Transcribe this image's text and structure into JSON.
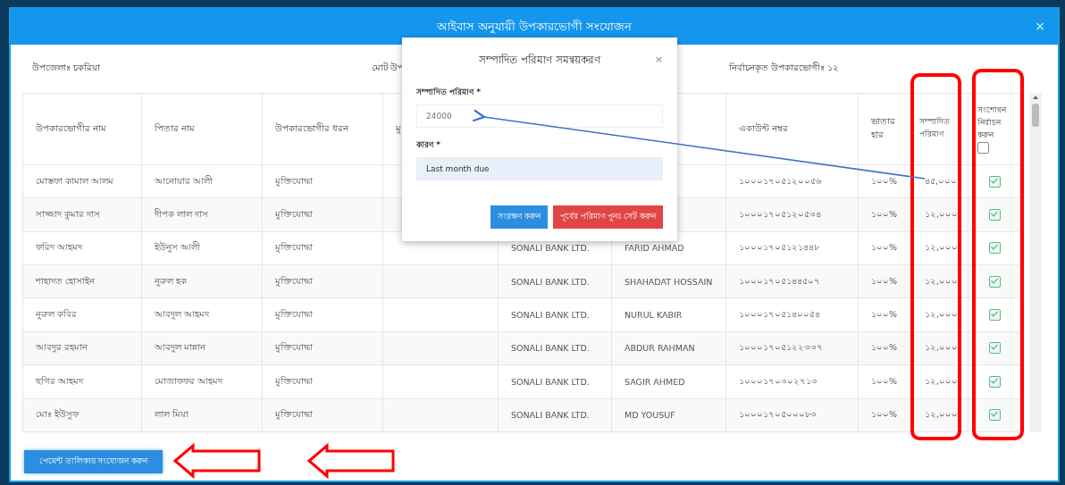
{
  "dialog": {
    "title": "আইবাস অনুযায়ী উপকারভোগী সংযোজন",
    "close": "×"
  },
  "info": {
    "upazila": "উপজেলাঃ চকরিয়া",
    "total": "মোট উপ",
    "selected_count": "নির্বাচনকৃত উপকারভোগীঃ ১২"
  },
  "table": {
    "columns": [
      "উপকারভোগীর নাম",
      "পিতার নাম",
      "উপকারভোগীর ধরন",
      "মু",
      null,
      null,
      "একাউন্ট নম্বর",
      "ভাতার হার",
      "সম্পাদিত পরিমাণ",
      "সংশোধন নির্বাচন করুন"
    ],
    "select_all": {
      "checked": false
    },
    "rows": [
      {
        "cells": [
          "মোস্তফা কামাল আলম",
          "আনোয়ার আলী",
          "মুক্তিযোদ্ধা",
          null,
          null,
          null,
          "১০০০১৭০৫১২০০৫৬",
          "১০০%",
          "৪৫,০০০"
        ],
        "checked": true
      },
      {
        "cells": [
          "সাজ্জাদ কুমার দাস",
          "দীপক লাল দাস",
          "মুক্তিযোদ্ধা",
          null,
          null,
          null,
          "১০০০১৭০৫১২০৫৩৪",
          "১০০%",
          "১২,০০০"
        ],
        "checked": true
      },
      {
        "cells": [
          "ফরিদ আহমদ",
          "ইউনুস আলী",
          "মুক্তিযোদ্ধা",
          null,
          "SONALI BANK LTD.",
          "FARID AHMAD",
          "১০০০১৭০৫১২১৪৪৮",
          "১০০%",
          "১২,০০০"
        ],
        "checked": true
      },
      {
        "cells": [
          "শাহাদত হোসাইন",
          "নুরুল হক",
          "মুক্তিযোদ্ধা",
          null,
          "SONALI BANK LTD.",
          "SHAHADAT HOSSAIN",
          "১০০০১৭০৫১৪৪৫০৭",
          "১০০%",
          "১২,০০০"
        ],
        "checked": true
      },
      {
        "cells": [
          "নুরুল কবির",
          "আবদুল আহমদ",
          "মুক্তিযোদ্ধা",
          null,
          "SONALI BANK LTD.",
          "NURUL KABIR",
          "১০০০১৭০৫১৪০০৫৪",
          "১০০%",
          "১২,০০০"
        ],
        "checked": true
      },
      {
        "cells": [
          "আবদুর রহমান",
          "আবদুল মান্নান",
          "মুক্তিযোদ্ধা",
          null,
          "SONALI BANK LTD.",
          "ABDUR RAHMAN",
          "১০০০১৭০৫১২২৩৩৭",
          "১০০%",
          "১২,০০০"
        ],
        "checked": true
      },
      {
        "cells": [
          "ছগির আহমদ",
          "মোজাফফর আহমদ",
          "মুক্তিযোদ্ধা",
          null,
          "SONALI BANK LTD.",
          "SAGIR AHMED",
          "১০০০১৭০৩০২৭১৩",
          "১০০%",
          "১২,০০০"
        ],
        "checked": true
      },
      {
        "cells": [
          "মোঃ ইউসুফ",
          "লাল মিয়া",
          "মুক্তিযোদ্ধা",
          null,
          "SONALI BANK LTD.",
          "MD YOUSUF",
          "১০০০১৭০৫০০০৮৩",
          "১০০%",
          "১২,০০০"
        ],
        "checked": true
      }
    ]
  },
  "popup": {
    "title": "সম্পাদিত পরিমাণ সমন্বয়করণ",
    "close": "×",
    "amount_label": "সম্পাদিত পরিমাণ *",
    "amount_placeholder": "24000",
    "reason_label": "কারণ *",
    "reason_value": "Last month due",
    "save": "সংরক্ষণ করুন",
    "reset": "পূর্বের পরিমাণ পুনঃ সেট করুন"
  },
  "add_button": "পেমেন্ট তালিকায় সংযোজন করুন"
}
